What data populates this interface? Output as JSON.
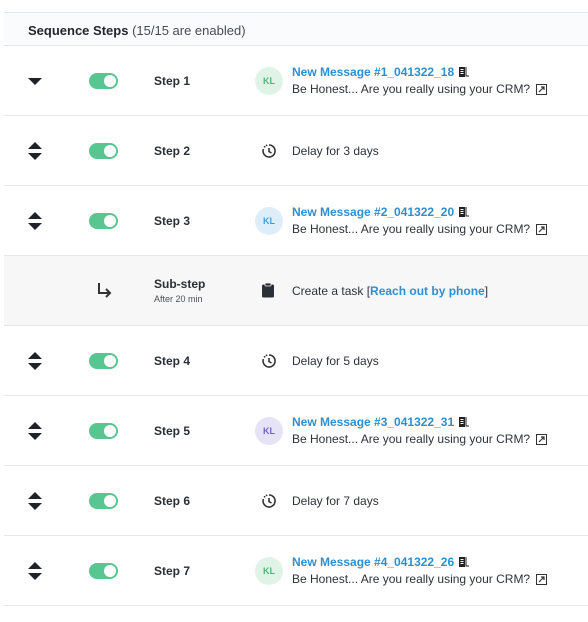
{
  "header": {
    "title": "Sequence Steps",
    "count": "(15/15 are enabled)"
  },
  "steps": [
    {
      "label": "Step 1",
      "avatar": "KL",
      "message": "New Message #1_041322_18",
      "subject": "Be Honest... Are you really using your CRM?"
    },
    {
      "label": "Step 2",
      "delay": "Delay for 3 days"
    },
    {
      "label": "Step 3",
      "avatar": "KL",
      "message": "New Message #2_041322_20",
      "subject": "Be Honest... Are you really using your CRM?"
    },
    {
      "label": "Sub-step",
      "sublabel": "After 20 min",
      "task_prefix": "Create a task [",
      "task_link": "Reach out by phone",
      "task_suffix": "]"
    },
    {
      "label": "Step 4",
      "delay": "Delay for 5 days"
    },
    {
      "label": "Step 5",
      "avatar": "KL",
      "message": "New Message #3_041322_31",
      "subject": "Be Honest... Are you really using your CRM?"
    },
    {
      "label": "Step 6",
      "delay": "Delay for 7 days"
    },
    {
      "label": "Step 7",
      "avatar": "KL",
      "message": "New Message #4_041322_26",
      "subject": "Be Honest... Are you really using your CRM?"
    }
  ],
  "colors": {
    "toggle_on": "#58c690",
    "link": "#2e8fd0",
    "avatar1": "#dff4e6",
    "avatar2": "#ddeef9",
    "avatar3": "#e6e3f6"
  },
  "icons": {
    "expand": "triangle-down-icon",
    "reorder": "sort-arrows-icon",
    "sub": "return-arrow-icon",
    "delay": "clock-icon",
    "task": "clipboard-icon",
    "template": "document-icon",
    "open": "external-link-icon"
  }
}
